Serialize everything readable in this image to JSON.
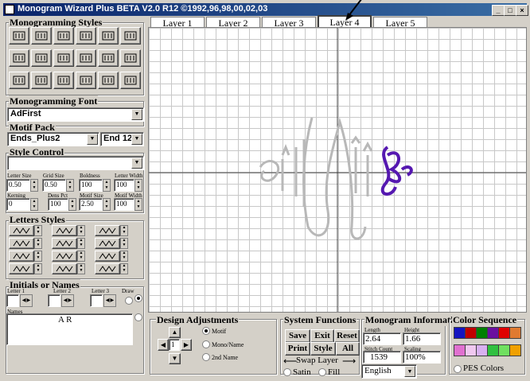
{
  "window": {
    "title": "Monogram Wizard Plus BETA V2.0 R12 ©1992,96,98,00,02,03",
    "min": "_",
    "max": "□",
    "close": "×"
  },
  "tabs": [
    "Layer 1",
    "Layer 2",
    "Layer 3",
    "Layer 4",
    "Layer 5"
  ],
  "left": {
    "styles_title": "Monogramming Styles",
    "font_title": "Monogramming Font",
    "font_value": "AdFirst",
    "motif_title": "Motif Pack",
    "motif_value": "Ends_Plus2",
    "motif_end": "End 12",
    "style_control_title": "Style Control",
    "style_control_value": "",
    "labels": {
      "letter_size": "Letter Size",
      "grid_size": "Grid Size",
      "boldness": "Boldness",
      "letter_width": "Letter Width",
      "kerning": "Kerning",
      "dens_pct": "Dens Pct",
      "motif_size": "Motif Size",
      "motif_width": "Motif Width"
    },
    "values": {
      "letter_size": "0.50",
      "grid_size": "0.50",
      "boldness": "100",
      "letter_width": "100",
      "kerning": "0",
      "dens_pct": "100",
      "motif_size": "2.50",
      "motif_width": "100"
    },
    "letters_styles_title": "Letters Styles",
    "initials_title": "Initials or Names",
    "letter1": "Letter 1",
    "letter2": "Letter 2",
    "letter3": "Letter 3",
    "draw": "Draw",
    "names_label": "Names",
    "names_value": "A R"
  },
  "bottom": {
    "design_title": "Design Adjustments",
    "motif": "Motif",
    "mono": "Mono/Name",
    "name2": "2nd Name",
    "step_value": "1",
    "system_title": "System Functions",
    "save": "Save",
    "exit": "Exit",
    "reset": "Reset",
    "print": "Print",
    "style": "Style",
    "all": "All",
    "swap": "Swap Layer",
    "satin": "Satin",
    "fill": "Fill",
    "info_title": "Monogram Information",
    "length_lbl": "Length",
    "height_lbl": "Height",
    "length": "2.64",
    "height": "1.66",
    "stitch_lbl": "Stitch Count",
    "scaling_lbl": "Scaling",
    "stitch": "1539",
    "scaling": "100%",
    "language": "English",
    "color_title": "Color Sequence",
    "pes": "PES Colors",
    "colors_row1": [
      "#1515c0",
      "#c00000",
      "#008000",
      "#6a0fa0",
      "#e00000",
      "#e07a30"
    ],
    "colors_row2": [
      "#e070d0",
      "#f0c8f0",
      "#d8b0f0",
      "#30c040",
      "#70e060",
      "#f0a000"
    ]
  }
}
